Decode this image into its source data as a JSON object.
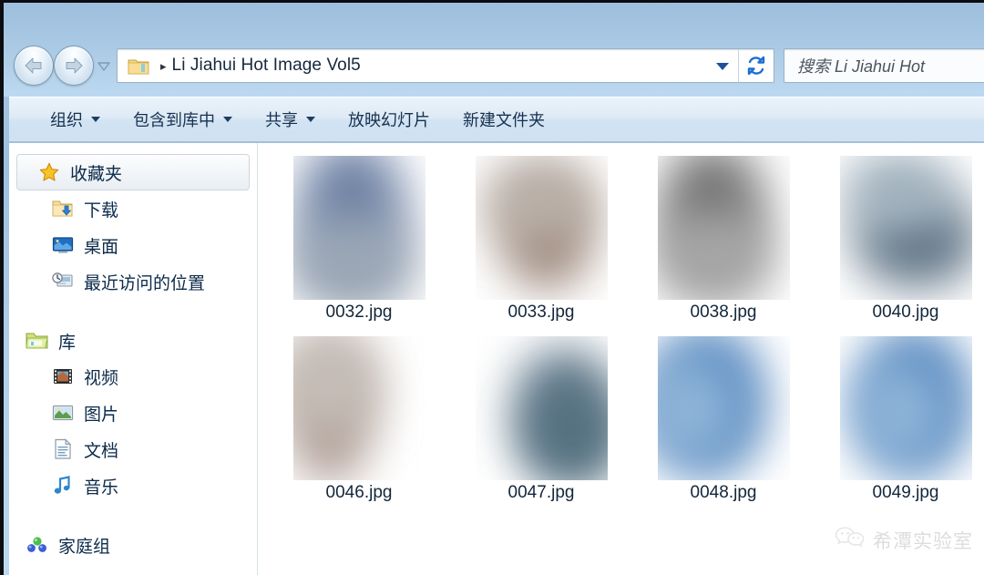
{
  "window": {
    "title": "Li Jiahui Hot Image Vol5"
  },
  "nav": {
    "back_label": "后退",
    "forward_label": "前进",
    "history_label": "最近浏览的位置"
  },
  "address": {
    "folder_icon": "folder-icon",
    "separator": "▸",
    "path_text": "Li Jiahui Hot Image Vol5",
    "dropdown_icon": "chevron-down-icon",
    "refresh_icon": "refresh-icon"
  },
  "search": {
    "placeholder": "搜索 Li Jiahui Hot",
    "icon": "search-icon"
  },
  "toolbar": {
    "items": [
      {
        "label": "组织",
        "has_caret": true
      },
      {
        "label": "包含到库中",
        "has_caret": true
      },
      {
        "label": "共享",
        "has_caret": true
      },
      {
        "label": "放映幻灯片",
        "has_caret": false
      },
      {
        "label": "新建文件夹",
        "has_caret": false
      }
    ]
  },
  "sidebar": {
    "groups": [
      {
        "header": {
          "label": "收藏夹",
          "icon": "star-icon",
          "highlighted": true
        },
        "items": [
          {
            "label": "下载",
            "icon": "download-folder-icon"
          },
          {
            "label": "桌面",
            "icon": "desktop-icon"
          },
          {
            "label": "最近访问的位置",
            "icon": "recent-places-icon"
          }
        ]
      },
      {
        "header": {
          "label": "库",
          "icon": "library-icon",
          "highlighted": false
        },
        "items": [
          {
            "label": "视频",
            "icon": "video-icon"
          },
          {
            "label": "图片",
            "icon": "pictures-icon"
          },
          {
            "label": "文档",
            "icon": "documents-icon"
          },
          {
            "label": "音乐",
            "icon": "music-icon"
          }
        ]
      },
      {
        "header": {
          "label": "家庭组",
          "icon": "homegroup-icon",
          "highlighted": false
        },
        "items": []
      }
    ]
  },
  "content": {
    "files": [
      {
        "name": "0032.jpg",
        "tint": "#6b7fa3",
        "tint2": "#9aa6b4"
      },
      {
        "name": "0033.jpg",
        "tint": "#9a8478",
        "tint2": "#b9b0a8"
      },
      {
        "name": "0038.jpg",
        "tint": "#6f6f70",
        "tint2": "#a5a5a6"
      },
      {
        "name": "0040.jpg",
        "tint": "#5d7284",
        "tint2": "#9fb0bc"
      },
      {
        "name": "0046.jpg",
        "tint": "#a8948b",
        "tint2": "#c5bdb7"
      },
      {
        "name": "0047.jpg",
        "tint": "#5f7789",
        "tint2": "#a2b4c0"
      },
      {
        "name": "0048.jpg",
        "tint": "#4a7fba",
        "tint2": "#8fb4d8"
      },
      {
        "name": "0049.jpg",
        "tint": "#4a7fba",
        "tint2": "#8fb4d8"
      }
    ]
  },
  "watermark": {
    "icon": "wechat-icon",
    "text": "希潭实验室"
  },
  "colors": {
    "frame": "#a9c6e2",
    "accent": "#1d6fd4",
    "text": "#0b2a4a",
    "folder_yellow": "#f3c352"
  }
}
